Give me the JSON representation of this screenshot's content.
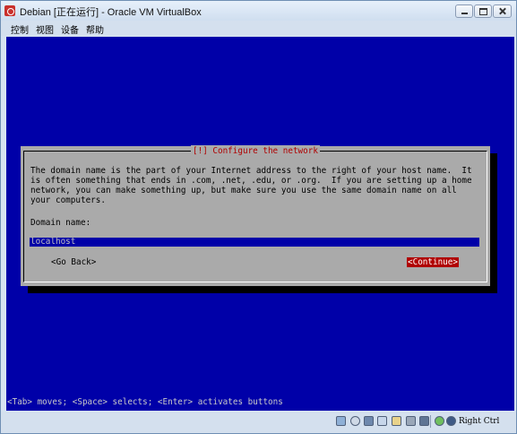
{
  "window": {
    "title": "Debian [正在运行] - Oracle VM VirtualBox"
  },
  "menu": {
    "items": [
      {
        "label": "控制"
      },
      {
        "label": "视图"
      },
      {
        "label": "设备"
      },
      {
        "label": "帮助"
      }
    ]
  },
  "installer": {
    "dialog_title": "[!] Configure the network",
    "description": "The domain name is the part of your Internet address to the right of your host name.  It\nis often something that ends in .com, .net, .edu, or .org.  If you are setting up a home\nnetwork, you can make something up, but make sure you use the same domain name on all\nyour computers.",
    "domain_label": "Domain name:",
    "domain_value": "localhost",
    "go_back_label": "<Go Back>",
    "continue_label": "<Continue>",
    "hint": "<Tab> moves; <Space> selects; <Enter> activates buttons"
  },
  "status": {
    "host_key": "Right Ctrl",
    "icons": [
      "hard-disk-icon",
      "optical-drive-icon",
      "floppy-icon",
      "network-icon",
      "shared-folder-icon",
      "usb-icon",
      "display-icon",
      "mouse-integration-icon",
      "capture-icon"
    ]
  },
  "colors": {
    "screen_bg": "#0000a8",
    "dialog_bg": "#aaaaaa",
    "title_red": "#b00000",
    "selected_button_bg": "#b00000"
  }
}
